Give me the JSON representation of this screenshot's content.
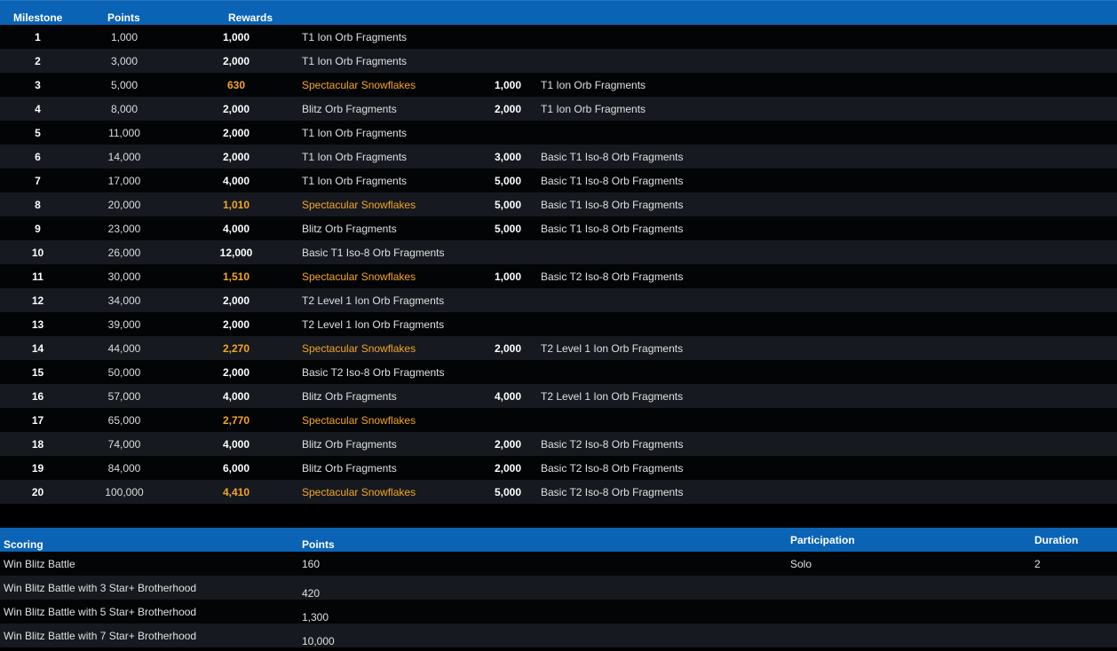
{
  "milestones_header": {
    "milestone": "Milestone",
    "points": "Points",
    "rewards": "Rewards"
  },
  "milestones": [
    {
      "milestone": "1",
      "points": "1,000",
      "r1": "1,000",
      "n1": "T1 Ion Orb Fragments",
      "r2": "",
      "n2": "",
      "special": false
    },
    {
      "milestone": "2",
      "points": "3,000",
      "r1": "2,000",
      "n1": "T1 Ion Orb Fragments",
      "r2": "",
      "n2": "",
      "special": false
    },
    {
      "milestone": "3",
      "points": "5,000",
      "r1": "630",
      "n1": "Spectacular Snowflakes",
      "r2": "1,000",
      "n2": "T1 Ion Orb Fragments",
      "special": true
    },
    {
      "milestone": "4",
      "points": "8,000",
      "r1": "2,000",
      "n1": "Blitz Orb Fragments",
      "r2": "2,000",
      "n2": "T1 Ion Orb Fragments",
      "special": false
    },
    {
      "milestone": "5",
      "points": "11,000",
      "r1": "2,000",
      "n1": "T1 Ion Orb Fragments",
      "r2": "",
      "n2": "",
      "special": false
    },
    {
      "milestone": "6",
      "points": "14,000",
      "r1": "2,000",
      "n1": "T1 Ion Orb Fragments",
      "r2": "3,000",
      "n2": "Basic T1 Iso-8 Orb Fragments",
      "special": false
    },
    {
      "milestone": "7",
      "points": "17,000",
      "r1": "4,000",
      "n1": "T1 Ion Orb Fragments",
      "r2": "5,000",
      "n2": "Basic T1 Iso-8 Orb Fragments",
      "special": false
    },
    {
      "milestone": "8",
      "points": "20,000",
      "r1": "1,010",
      "n1": "Spectacular Snowflakes",
      "r2": "5,000",
      "n2": "Basic T1 Iso-8 Orb Fragments",
      "special": true
    },
    {
      "milestone": "9",
      "points": "23,000",
      "r1": "4,000",
      "n1": "Blitz Orb Fragments",
      "r2": "5,000",
      "n2": "Basic T1 Iso-8 Orb Fragments",
      "special": false
    },
    {
      "milestone": "10",
      "points": "26,000",
      "r1": "12,000",
      "n1": "Basic T1 Iso-8 Orb Fragments",
      "r2": "",
      "n2": "",
      "special": false
    },
    {
      "milestone": "11",
      "points": "30,000",
      "r1": "1,510",
      "n1": "Spectacular Snowflakes",
      "r2": "1,000",
      "n2": "Basic T2 Iso-8 Orb Fragments",
      "special": true
    },
    {
      "milestone": "12",
      "points": "34,000",
      "r1": "2,000",
      "n1": "T2 Level 1 Ion Orb Fragments",
      "r2": "",
      "n2": "",
      "special": false
    },
    {
      "milestone": "13",
      "points": "39,000",
      "r1": "2,000",
      "n1": "T2 Level 1 Ion Orb Fragments",
      "r2": "",
      "n2": "",
      "special": false
    },
    {
      "milestone": "14",
      "points": "44,000",
      "r1": "2,270",
      "n1": "Spectacular Snowflakes",
      "r2": "2,000",
      "n2": "T2 Level 1 Ion Orb Fragments",
      "special": true
    },
    {
      "milestone": "15",
      "points": "50,000",
      "r1": "2,000",
      "n1": "Basic T2 Iso-8 Orb Fragments",
      "r2": "",
      "n2": "",
      "special": false
    },
    {
      "milestone": "16",
      "points": "57,000",
      "r1": "4,000",
      "n1": "Blitz Orb Fragments",
      "r2": "4,000",
      "n2": "T2 Level 1 Ion Orb Fragments",
      "special": false
    },
    {
      "milestone": "17",
      "points": "65,000",
      "r1": "2,770",
      "n1": "Spectacular Snowflakes",
      "r2": "",
      "n2": "",
      "special": true
    },
    {
      "milestone": "18",
      "points": "74,000",
      "r1": "4,000",
      "n1": "Blitz Orb Fragments",
      "r2": "2,000",
      "n2": "Basic T2 Iso-8 Orb Fragments",
      "special": false
    },
    {
      "milestone": "19",
      "points": "84,000",
      "r1": "6,000",
      "n1": "Blitz Orb Fragments",
      "r2": "2,000",
      "n2": "Basic T2 Iso-8 Orb Fragments",
      "special": false
    },
    {
      "milestone": "20",
      "points": "100,000",
      "r1": "4,410",
      "n1": "Spectacular Snowflakes",
      "r2": "5,000",
      "n2": "Basic T2 Iso-8 Orb Fragments",
      "special": true
    }
  ],
  "scoring_header": {
    "scoring": "Scoring",
    "points": "Points",
    "participation": "Participation",
    "duration": "Duration"
  },
  "scoring": [
    {
      "label": "Win Blitz Battle",
      "points": "160",
      "participation": "Solo",
      "duration": "2"
    },
    {
      "label": "Win Blitz Battle with 3 Star+ Brotherhood",
      "points": "420",
      "participation": "",
      "duration": ""
    },
    {
      "label": "Win Blitz Battle with 5 Star+ Brotherhood",
      "points": "1,300",
      "participation": "",
      "duration": ""
    },
    {
      "label": "Win Blitz Battle with 7 Star+ Brotherhood",
      "points": "10,000",
      "participation": "",
      "duration": ""
    }
  ],
  "colors": {
    "header_bg": "#0a63b5",
    "row_alt": "#16191f",
    "row_base": "#030406",
    "special_text": "#f5a623"
  }
}
